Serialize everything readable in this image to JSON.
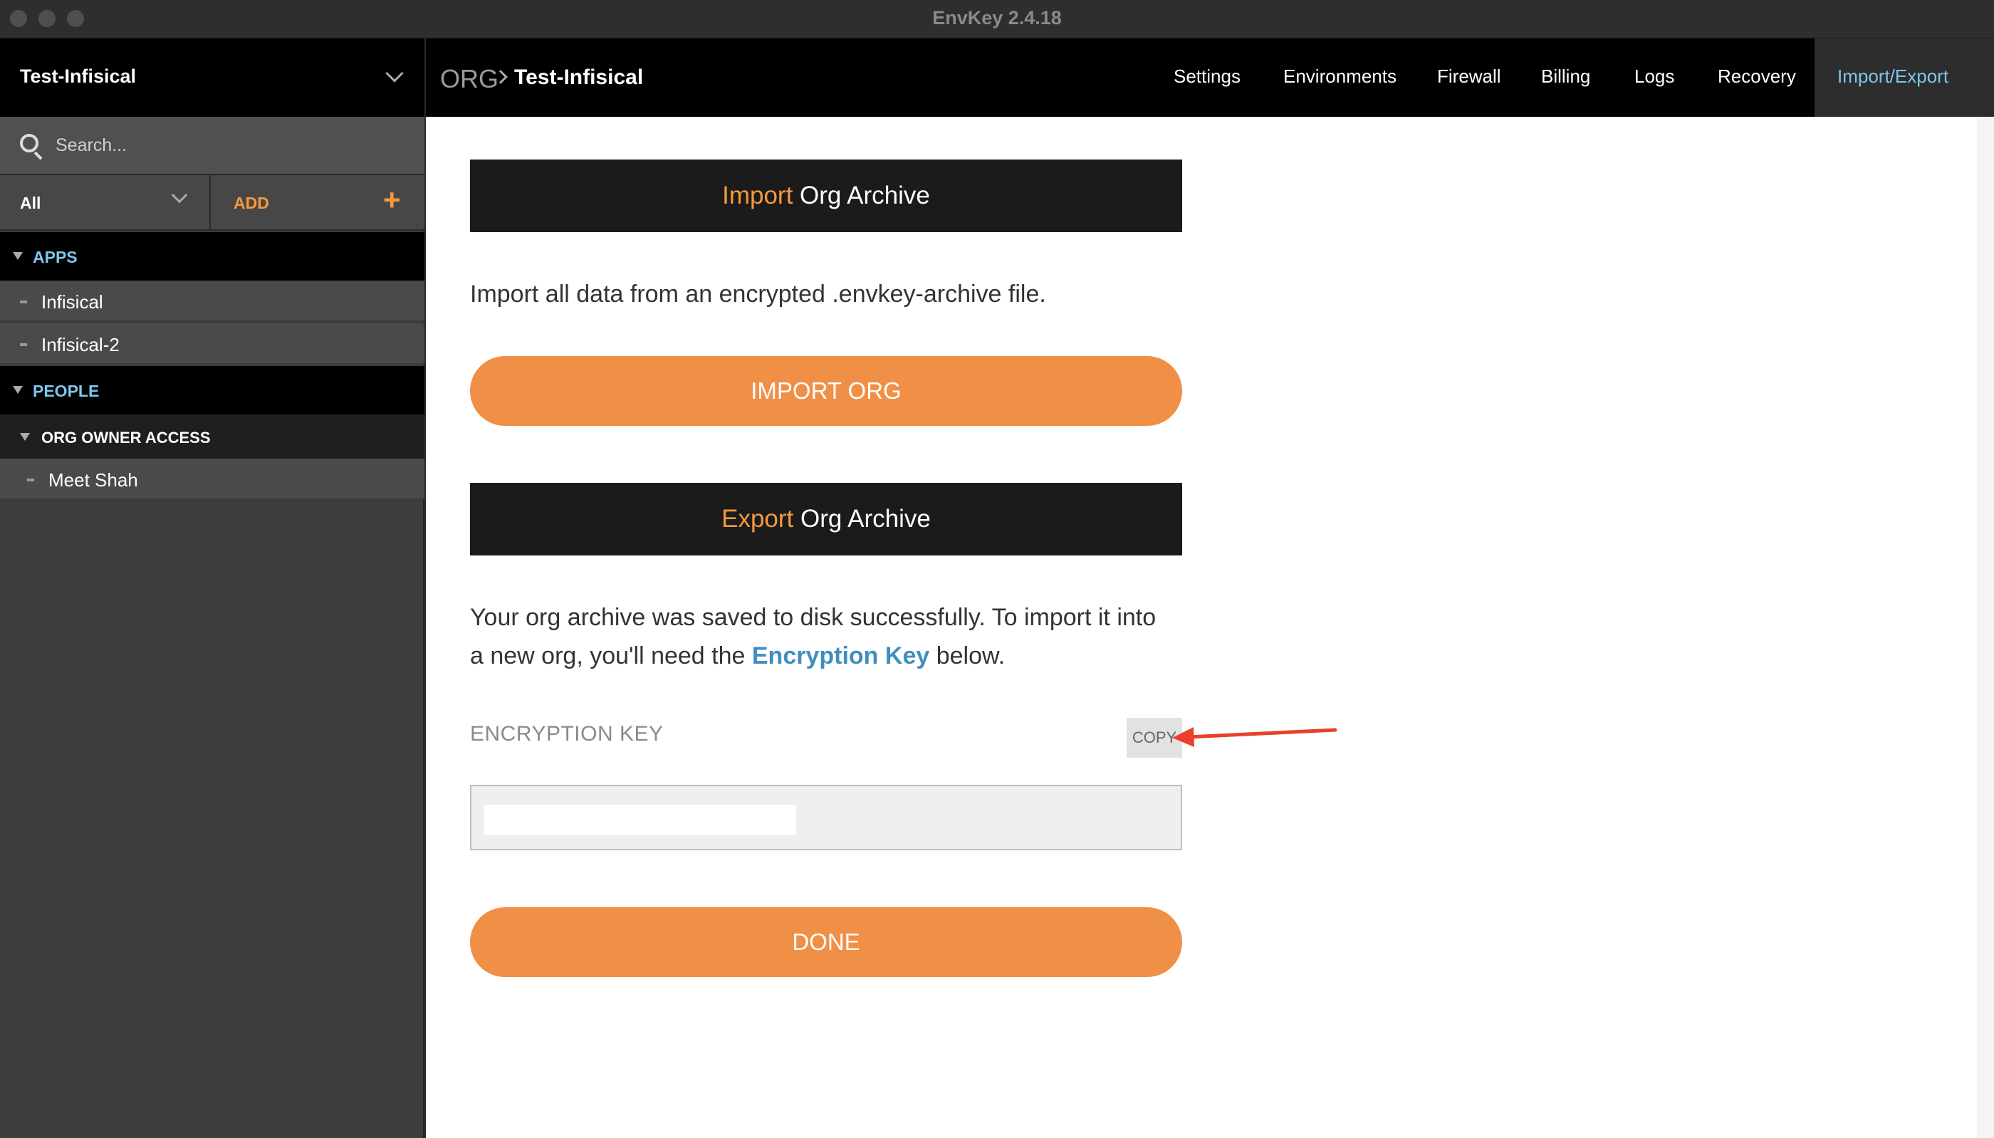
{
  "window": {
    "title": "EnvKey 2.4.18"
  },
  "sidebar": {
    "org_name": "Test-Infisical",
    "search_placeholder": "Search...",
    "filter_label": "All",
    "add_label": "ADD",
    "add_symbol": "+",
    "sections": {
      "apps": {
        "label": "APPS",
        "items": [
          "Infisical",
          "Infisical-2"
        ]
      },
      "people": {
        "label": "PEOPLE",
        "group_label": "ORG OWNER ACCESS",
        "items": [
          "Meet Shah"
        ]
      }
    }
  },
  "topnav": {
    "breadcrumb_root": "ORG",
    "breadcrumb_current": "Test-Infisical",
    "tabs": [
      "Settings",
      "Environments",
      "Firewall",
      "Billing",
      "Logs",
      "Recovery",
      "Import/Export"
    ],
    "active_tab": "Import/Export"
  },
  "import": {
    "heading_accent": "Import",
    "heading_rest": " Org Archive",
    "description": "Import all data from an encrypted .envkey-archive file.",
    "button_label": "IMPORT ORG"
  },
  "export": {
    "heading_accent": "Export",
    "heading_rest": " Org Archive",
    "message_line_1": "Your org archive was saved to disk successfully. To import it into",
    "message_line_2_pre": "a new org, you'll need the ",
    "message_link": "Encryption Key",
    "message_line_2_post": " below.",
    "key_label": "ENCRYPTION KEY",
    "copy_label": "COPY",
    "done_label": "DONE"
  },
  "colors": {
    "accent_orange": "#f08f46",
    "link_blue": "#3f8ebf",
    "active_tab": "#7fc6ec",
    "annotation_arrow": "#e8402a"
  }
}
